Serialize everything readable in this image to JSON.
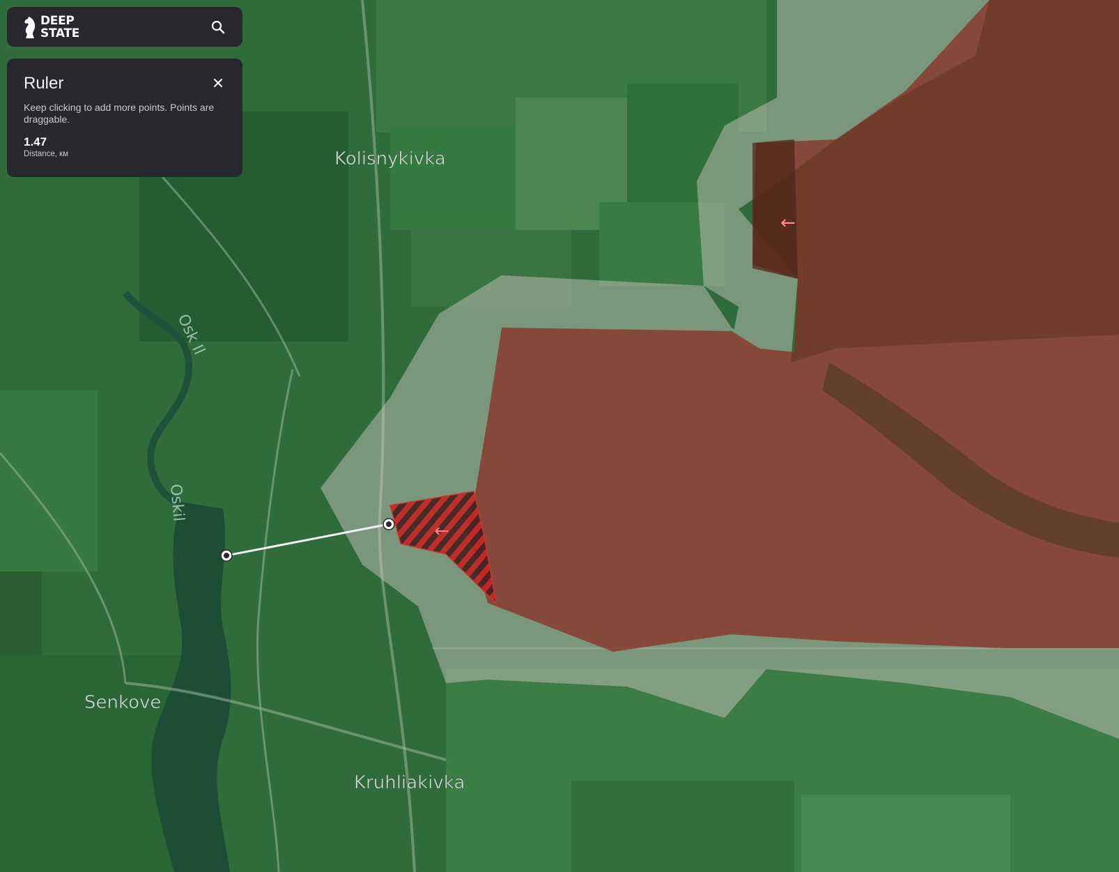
{
  "app": {
    "logo_line1": "DEEP",
    "logo_line2": "STATE",
    "search_icon": "search-icon"
  },
  "ruler": {
    "title": "Ruler",
    "hint": "Keep clicking to add more points. Points are draggable.",
    "distance_value": "1.47",
    "distance_label": "Distance, км",
    "close_icon": "close-icon"
  },
  "map": {
    "places": [
      "Kolisnykivka",
      "Senkove",
      "Kruhliakivka"
    ],
    "rivers": [
      "Osk Il",
      "Oskil"
    ],
    "movement_icon": "red-arrow-left-icon",
    "colors": {
      "occupied": "#8b2a22",
      "grey_zone": "#cfc6c2",
      "hatched_advance": "#c7241f",
      "terrain": "#2d6a3a"
    }
  }
}
